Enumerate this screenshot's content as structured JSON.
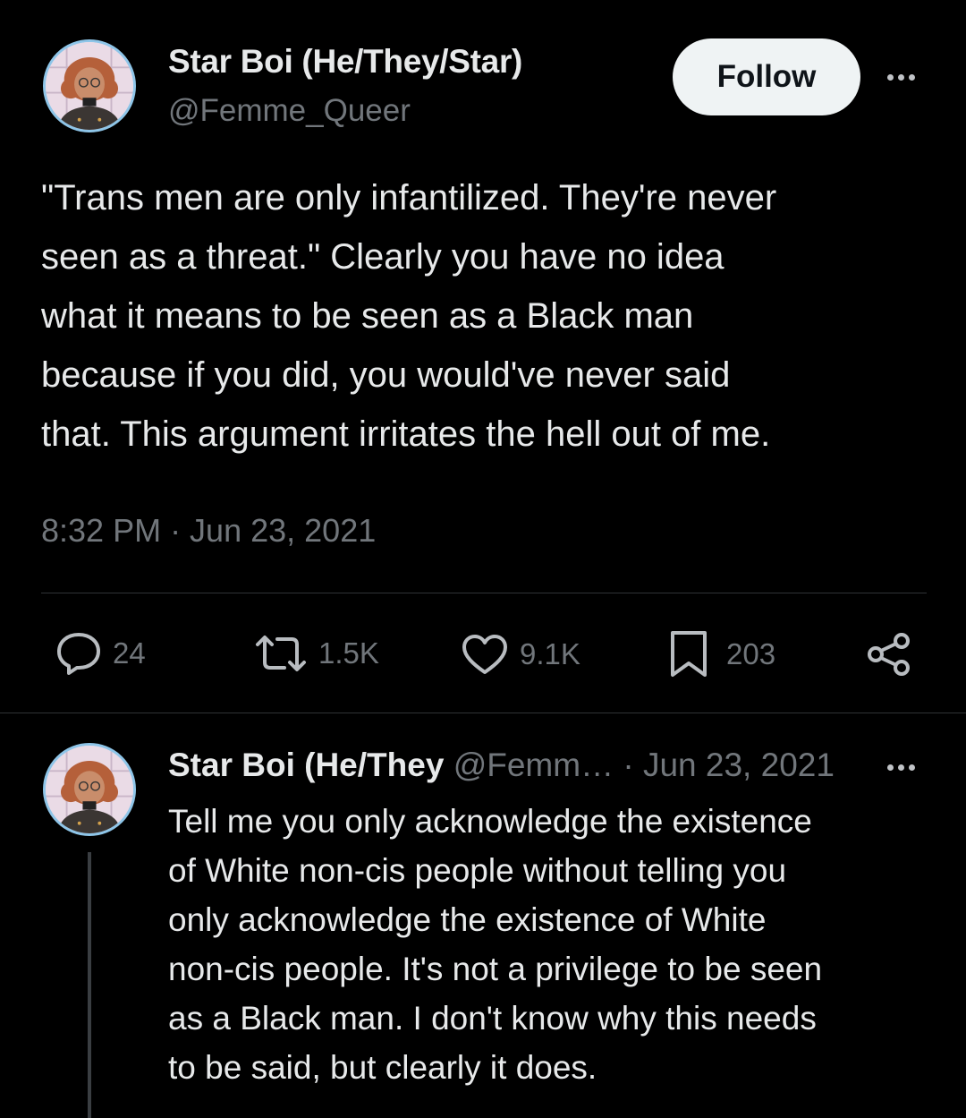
{
  "main_tweet": {
    "display_name": "Star Boi (He/They/Star)",
    "handle": "@Femme_Queer",
    "follow_label": "Follow",
    "text_lines": [
      "\"Trans men are only infantilized. They're never",
      "seen as a threat.\" Clearly you have no idea",
      "what it means to be seen as a Black man",
      "because if you did, you would've never said",
      "that. This argument irritates the hell out of me."
    ],
    "timestamp": "8:32 PM · Jun 23, 2021",
    "stats": {
      "replies": "24",
      "retweets": "1.5K",
      "likes": "9.1K",
      "bookmarks": "203"
    },
    "icons": [
      "more-icon",
      "reply-icon",
      "retweet-icon",
      "like-icon",
      "bookmark-icon",
      "share-icon"
    ]
  },
  "reply_tweet": {
    "display_name": "Star Boi (He/They",
    "handle": "@Femm…",
    "separator": "·",
    "date": "Jun 23, 2021",
    "text_lines": [
      "Tell me you only acknowledge the existence",
      "of White non-cis people without telling you",
      "only acknowledge the existence of White",
      "non-cis people. It's not a privilege to be seen",
      "as a Black man. I don't know why this needs",
      "to be said, but clearly it does."
    ]
  },
  "colors": {
    "background": "#000000",
    "primary_text": "#e7e9ea",
    "secondary_text": "#71767b",
    "follow_button_bg": "#eff3f4",
    "avatar_ring": "#8ec5e8"
  }
}
